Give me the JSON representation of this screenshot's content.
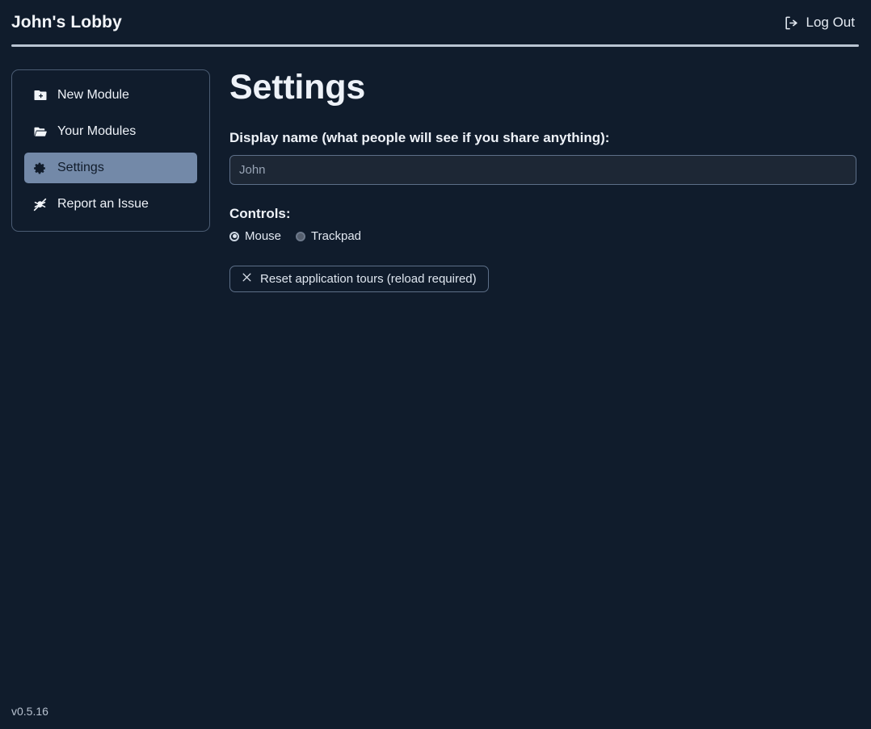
{
  "header": {
    "title": "John's Lobby",
    "logout_label": "Log Out",
    "logout_icon": "logout-arrow-icon"
  },
  "sidebar": {
    "items": [
      {
        "label": "New Module",
        "icon": "folder-plus-icon",
        "active": false
      },
      {
        "label": "Your Modules",
        "icon": "folder-open-icon",
        "active": false
      },
      {
        "label": "Settings",
        "icon": "gear-icon",
        "active": true
      },
      {
        "label": "Report an Issue",
        "icon": "bug-slash-icon",
        "active": false
      }
    ]
  },
  "main": {
    "page_title": "Settings",
    "display_name": {
      "label": "Display name (what people will see if you share anything):",
      "value": "",
      "placeholder": "John"
    },
    "controls": {
      "label": "Controls:",
      "options": [
        {
          "label": "Mouse",
          "selected": true
        },
        {
          "label": "Trackpad",
          "selected": false
        }
      ]
    },
    "reset_button": {
      "label": "Reset application tours (reload required)",
      "icon": "close-x-icon"
    }
  },
  "footer": {
    "version": "v0.5.16"
  },
  "colors": {
    "background": "#101c2c",
    "accent_highlight": "#7389a8",
    "border": "#5d6f88",
    "text": "#eef2f8",
    "divider": "#b9c4d2"
  }
}
